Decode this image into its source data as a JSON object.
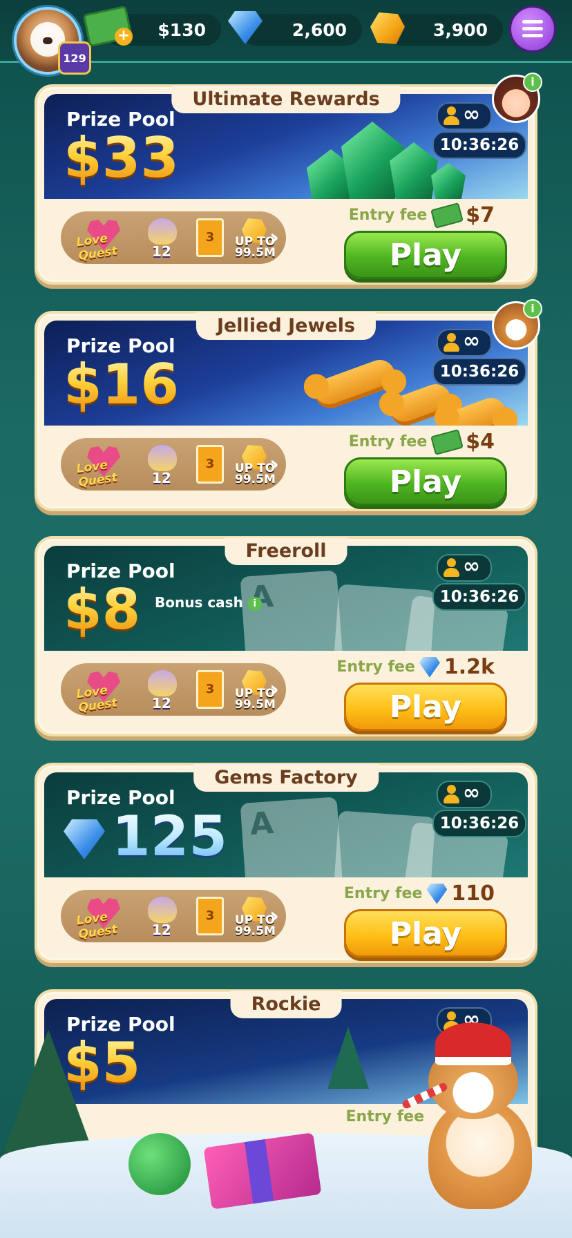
{
  "header": {
    "level": "129",
    "cash": "$130",
    "gems": "2,600",
    "gold": "3,900",
    "cash_plus": "+"
  },
  "rewards_common": {
    "love_quest": "Love Quest",
    "pot_count": "12",
    "tile_number": "3",
    "up_to": "UP TO",
    "up_to_value": "99.5M",
    "chevron": "›"
  },
  "labels": {
    "prize_pool": "Prize Pool",
    "entry_fee": "Entry fee",
    "play": "Play",
    "infinity": "∞",
    "bonus_cash": "Bonus cash",
    "info": "i"
  },
  "tournaments": [
    {
      "title": "Ultimate Rewards",
      "prize": "$33",
      "timer": "10:36:26",
      "fee": "$7",
      "fee_currency": "cash",
      "button": "green"
    },
    {
      "title": "Jellied Jewels",
      "prize": "$16",
      "timer": "10:36:26",
      "fee": "$4",
      "fee_currency": "cash",
      "button": "green"
    },
    {
      "title": "Freeroll",
      "prize": "$8",
      "timer": "10:36:26",
      "fee": "1.2k",
      "fee_currency": "gems",
      "button": "gold"
    },
    {
      "title": "Gems Factory",
      "prize": "125",
      "prize_currency": "gems",
      "timer": "10:36:26",
      "fee": "110",
      "fee_currency": "gems",
      "button": "gold"
    },
    {
      "title": "Rockie",
      "prize": "$5",
      "fee_partial": "Entry fee"
    }
  ],
  "colors": {
    "bg": "#1b6a63",
    "card": "#fbf1dc",
    "title_text": "#6a3d1f",
    "play_green": "#4fb521",
    "play_gold": "#ffbf18",
    "prize_gold": "#ffd13c"
  }
}
